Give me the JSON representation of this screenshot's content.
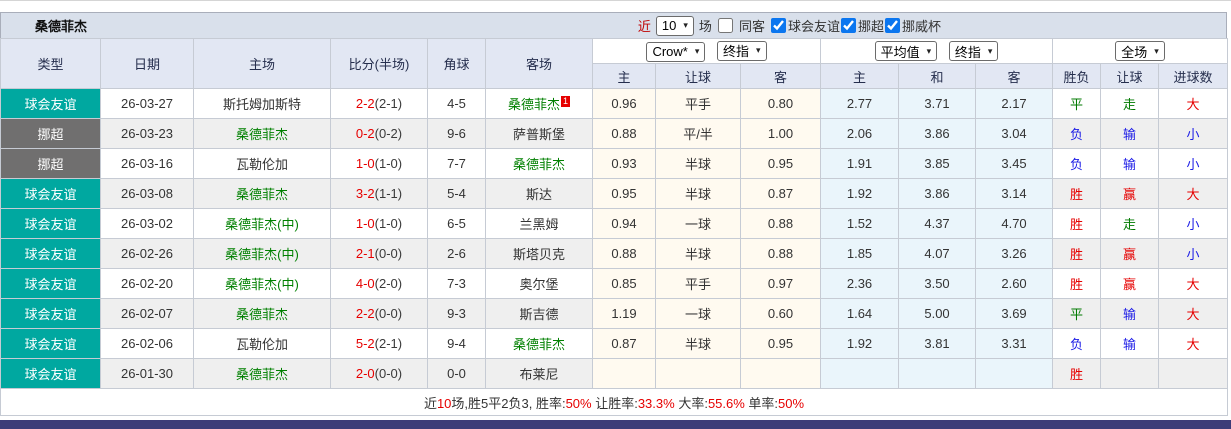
{
  "colors": {
    "friendly_bg": "#00A8A0",
    "league_bg": "#706F6F",
    "header_bg": "#E2E7F3",
    "teambar_bg": "#D9E0EB",
    "odds_bg": "#FFFAF0",
    "avg_bg": "#EAF5FB",
    "alt_row_bg": "#EFEFEF",
    "win_red": "#E60000",
    "lose_blue": "#1A1AE6",
    "draw_green": "#007A00",
    "team_green": "#008000",
    "score_red": "#E60000",
    "accent_checkbox": "#0B76EF",
    "bottom_bar": "#3C3C78"
  },
  "team_bar": {
    "team": "桑德菲杰",
    "near_label": "近",
    "near_value": "10",
    "games_label": "场",
    "same_away_label": "同客",
    "same_away_checked": false,
    "filters": [
      {
        "label": "球会友谊",
        "checked": true
      },
      {
        "label": "挪超",
        "checked": true
      },
      {
        "label": "挪威杯",
        "checked": true
      }
    ]
  },
  "header": {
    "cols": [
      "类型",
      "日期",
      "主场",
      "比分(半场)",
      "角球",
      "客场"
    ],
    "group1": {
      "select1": "Crow*",
      "select2": "终指",
      "cols": [
        "主",
        "让球",
        "客"
      ]
    },
    "group2": {
      "select1": "平均值",
      "select2": "终指",
      "cols": [
        "主",
        "和",
        "客"
      ]
    },
    "group3": {
      "select": "全场",
      "cols": [
        "胜负",
        "让球",
        "进球数"
      ]
    }
  },
  "rows": [
    {
      "type": "球会友谊",
      "league": false,
      "date": "26-03-27",
      "home": "斯托姆加斯特",
      "home_self": false,
      "score": "2-2",
      "half": "(2-1)",
      "corners": "4-5",
      "away": "桑德菲杰",
      "away_self": true,
      "badge": "1",
      "odds": [
        "0.96",
        "平手",
        "0.80"
      ],
      "avg": [
        "2.77",
        "3.71",
        "2.17"
      ],
      "res": [
        [
          "平",
          "green"
        ],
        [
          "走",
          "green"
        ],
        [
          "大",
          "red"
        ]
      ]
    },
    {
      "type": "挪超",
      "league": true,
      "date": "26-03-23",
      "home": "桑德菲杰",
      "home_self": true,
      "score": "0-2",
      "half": "(0-2)",
      "corners": "9-6",
      "away": "萨普斯堡",
      "away_self": false,
      "badge": "",
      "odds": [
        "0.88",
        "平/半",
        "1.00"
      ],
      "avg": [
        "2.06",
        "3.86",
        "3.04"
      ],
      "res": [
        [
          "负",
          "blue"
        ],
        [
          "输",
          "blue"
        ],
        [
          "小",
          "blue"
        ]
      ]
    },
    {
      "type": "挪超",
      "league": true,
      "date": "26-03-16",
      "home": "瓦勒伦加",
      "home_self": false,
      "score": "1-0",
      "half": "(1-0)",
      "corners": "7-7",
      "away": "桑德菲杰",
      "away_self": true,
      "badge": "",
      "odds": [
        "0.93",
        "半球",
        "0.95"
      ],
      "avg": [
        "1.91",
        "3.85",
        "3.45"
      ],
      "res": [
        [
          "负",
          "blue"
        ],
        [
          "输",
          "blue"
        ],
        [
          "小",
          "blue"
        ]
      ]
    },
    {
      "type": "球会友谊",
      "league": false,
      "date": "26-03-08",
      "home": "桑德菲杰",
      "home_self": true,
      "score": "3-2",
      "half": "(1-1)",
      "corners": "5-4",
      "away": "斯达",
      "away_self": false,
      "badge": "",
      "odds": [
        "0.95",
        "半球",
        "0.87"
      ],
      "avg": [
        "1.92",
        "3.86",
        "3.14"
      ],
      "res": [
        [
          "胜",
          "red"
        ],
        [
          "赢",
          "red"
        ],
        [
          "大",
          "red"
        ]
      ]
    },
    {
      "type": "球会友谊",
      "league": false,
      "date": "26-03-02",
      "home": "桑德菲杰(中)",
      "home_self": true,
      "score": "1-0",
      "half": "(1-0)",
      "corners": "6-5",
      "away": "兰黑姆",
      "away_self": false,
      "badge": "",
      "odds": [
        "0.94",
        "一球",
        "0.88"
      ],
      "avg": [
        "1.52",
        "4.37",
        "4.70"
      ],
      "res": [
        [
          "胜",
          "red"
        ],
        [
          "走",
          "green"
        ],
        [
          "小",
          "blue"
        ]
      ]
    },
    {
      "type": "球会友谊",
      "league": false,
      "date": "26-02-26",
      "home": "桑德菲杰(中)",
      "home_self": true,
      "score": "2-1",
      "half": "(0-0)",
      "corners": "2-6",
      "away": "斯塔贝克",
      "away_self": false,
      "badge": "",
      "odds": [
        "0.88",
        "半球",
        "0.88"
      ],
      "avg": [
        "1.85",
        "4.07",
        "3.26"
      ],
      "res": [
        [
          "胜",
          "red"
        ],
        [
          "赢",
          "red"
        ],
        [
          "小",
          "blue"
        ]
      ]
    },
    {
      "type": "球会友谊",
      "league": false,
      "date": "26-02-20",
      "home": "桑德菲杰(中)",
      "home_self": true,
      "score": "4-0",
      "half": "(2-0)",
      "corners": "7-3",
      "away": "奥尔堡",
      "away_self": false,
      "badge": "",
      "odds": [
        "0.85",
        "平手",
        "0.97"
      ],
      "avg": [
        "2.36",
        "3.50",
        "2.60"
      ],
      "res": [
        [
          "胜",
          "red"
        ],
        [
          "赢",
          "red"
        ],
        [
          "大",
          "red"
        ]
      ]
    },
    {
      "type": "球会友谊",
      "league": false,
      "date": "26-02-07",
      "home": "桑德菲杰",
      "home_self": true,
      "score": "2-2",
      "half": "(0-0)",
      "corners": "9-3",
      "away": "斯吉德",
      "away_self": false,
      "badge": "",
      "odds": [
        "1.19",
        "一球",
        "0.60"
      ],
      "avg": [
        "1.64",
        "5.00",
        "3.69"
      ],
      "res": [
        [
          "平",
          "green"
        ],
        [
          "输",
          "blue"
        ],
        [
          "大",
          "red"
        ]
      ]
    },
    {
      "type": "球会友谊",
      "league": false,
      "date": "26-02-06",
      "home": "瓦勒伦加",
      "home_self": false,
      "score": "5-2",
      "half": "(2-1)",
      "corners": "9-4",
      "away": "桑德菲杰",
      "away_self": true,
      "badge": "",
      "odds": [
        "0.87",
        "半球",
        "0.95"
      ],
      "avg": [
        "1.92",
        "3.81",
        "3.31"
      ],
      "res": [
        [
          "负",
          "blue"
        ],
        [
          "输",
          "blue"
        ],
        [
          "大",
          "red"
        ]
      ]
    },
    {
      "type": "球会友谊",
      "league": false,
      "date": "26-01-30",
      "home": "桑德菲杰",
      "home_self": true,
      "score": "2-0",
      "half": "(0-0)",
      "corners": "0-0",
      "away": "布莱尼",
      "away_self": false,
      "badge": "",
      "odds": [
        "",
        "",
        ""
      ],
      "avg": [
        "",
        "",
        ""
      ],
      "res": [
        [
          "胜",
          "red"
        ],
        [
          "",
          ""
        ],
        [
          "",
          ""
        ]
      ]
    }
  ],
  "footer": {
    "segments": [
      {
        "t": "近",
        "red": false
      },
      {
        "t": "10",
        "red": true
      },
      {
        "t": "场,胜5平2负3, 胜率:",
        "red": false
      },
      {
        "t": "50%",
        "red": true
      },
      {
        "t": " 让胜率:",
        "red": false
      },
      {
        "t": "33.3%",
        "red": true
      },
      {
        "t": " 大率:",
        "red": false
      },
      {
        "t": "55.6%",
        "red": true
      },
      {
        "t": " 单率:",
        "red": false
      },
      {
        "t": "50%",
        "red": true
      }
    ]
  }
}
